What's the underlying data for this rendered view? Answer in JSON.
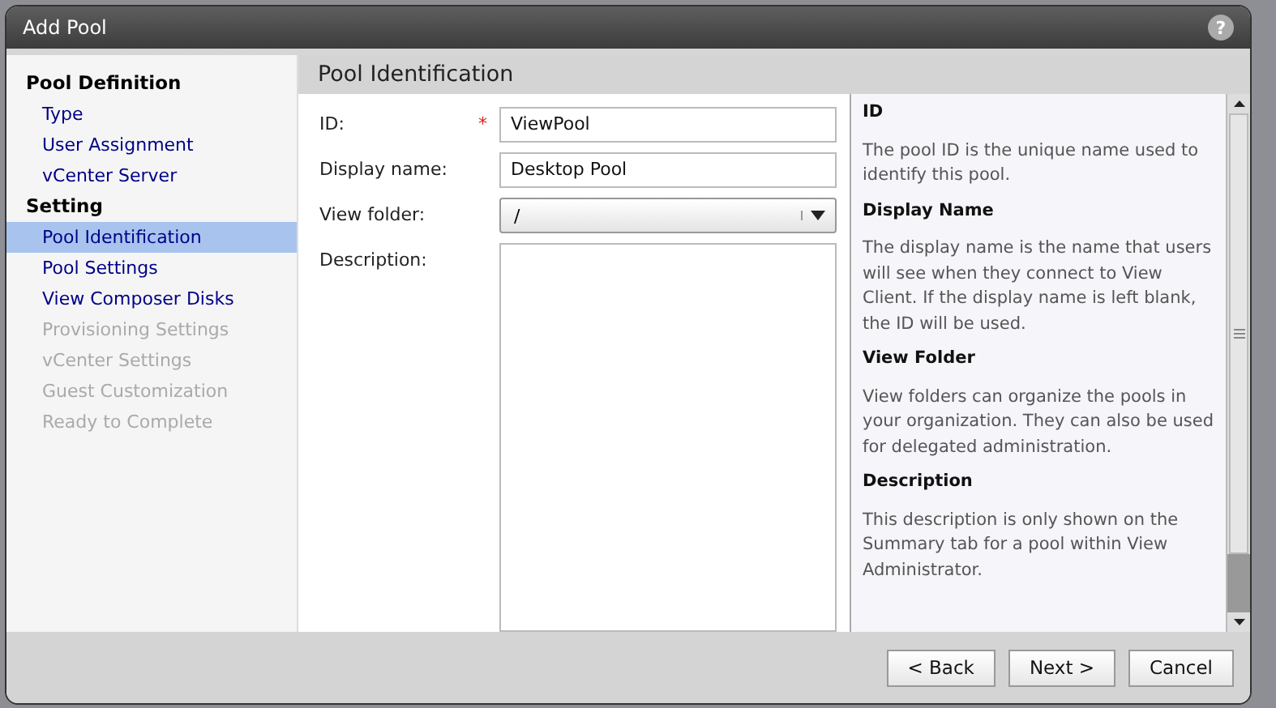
{
  "window": {
    "title": "Add Pool",
    "help_button": "?"
  },
  "sidebar": {
    "items": [
      {
        "kind": "heading",
        "label": "Pool Definition"
      },
      {
        "kind": "step",
        "label": "Type",
        "selected": false,
        "disabled": false
      },
      {
        "kind": "step",
        "label": "User Assignment",
        "selected": false,
        "disabled": false
      },
      {
        "kind": "step",
        "label": "vCenter Server",
        "selected": false,
        "disabled": false
      },
      {
        "kind": "heading",
        "label": "Setting"
      },
      {
        "kind": "step",
        "label": "Pool Identification",
        "selected": true,
        "disabled": false
      },
      {
        "kind": "step",
        "label": "Pool Settings",
        "selected": false,
        "disabled": false
      },
      {
        "kind": "step",
        "label": "View Composer Disks",
        "selected": false,
        "disabled": false
      },
      {
        "kind": "step",
        "label": "Provisioning Settings",
        "selected": false,
        "disabled": true
      },
      {
        "kind": "step",
        "label": "vCenter Settings",
        "selected": false,
        "disabled": true
      },
      {
        "kind": "step",
        "label": "Guest Customization",
        "selected": false,
        "disabled": true
      },
      {
        "kind": "step",
        "label": "Ready to Complete",
        "selected": false,
        "disabled": true
      }
    ]
  },
  "section_title": "Pool Identification",
  "form": {
    "fields": [
      {
        "kind": "text",
        "label": "ID:",
        "value": "ViewPool",
        "required": true
      },
      {
        "kind": "text",
        "label": "Display name:",
        "value": "Desktop Pool",
        "required": false
      },
      {
        "kind": "select",
        "label": "View folder:",
        "value": "/",
        "required": false
      },
      {
        "kind": "textarea",
        "label": "Description:",
        "required": false
      }
    ],
    "required_mark": "*"
  },
  "help": [
    {
      "heading": "ID",
      "text": "The pool ID is the unique name used to identify this pool."
    },
    {
      "heading": "Display Name",
      "text": "The display name is the name that users will see when they connect to View Client. If the display name is left blank, the ID will be used."
    },
    {
      "heading": "View Folder",
      "text": "View folders can organize the pools in your organization. They can also be used for delegated administration."
    },
    {
      "heading": "Description",
      "text": "This description is only shown on the Summary tab for a pool within View Administrator."
    }
  ],
  "buttons": [
    "< Back",
    "Next >",
    "Cancel"
  ]
}
